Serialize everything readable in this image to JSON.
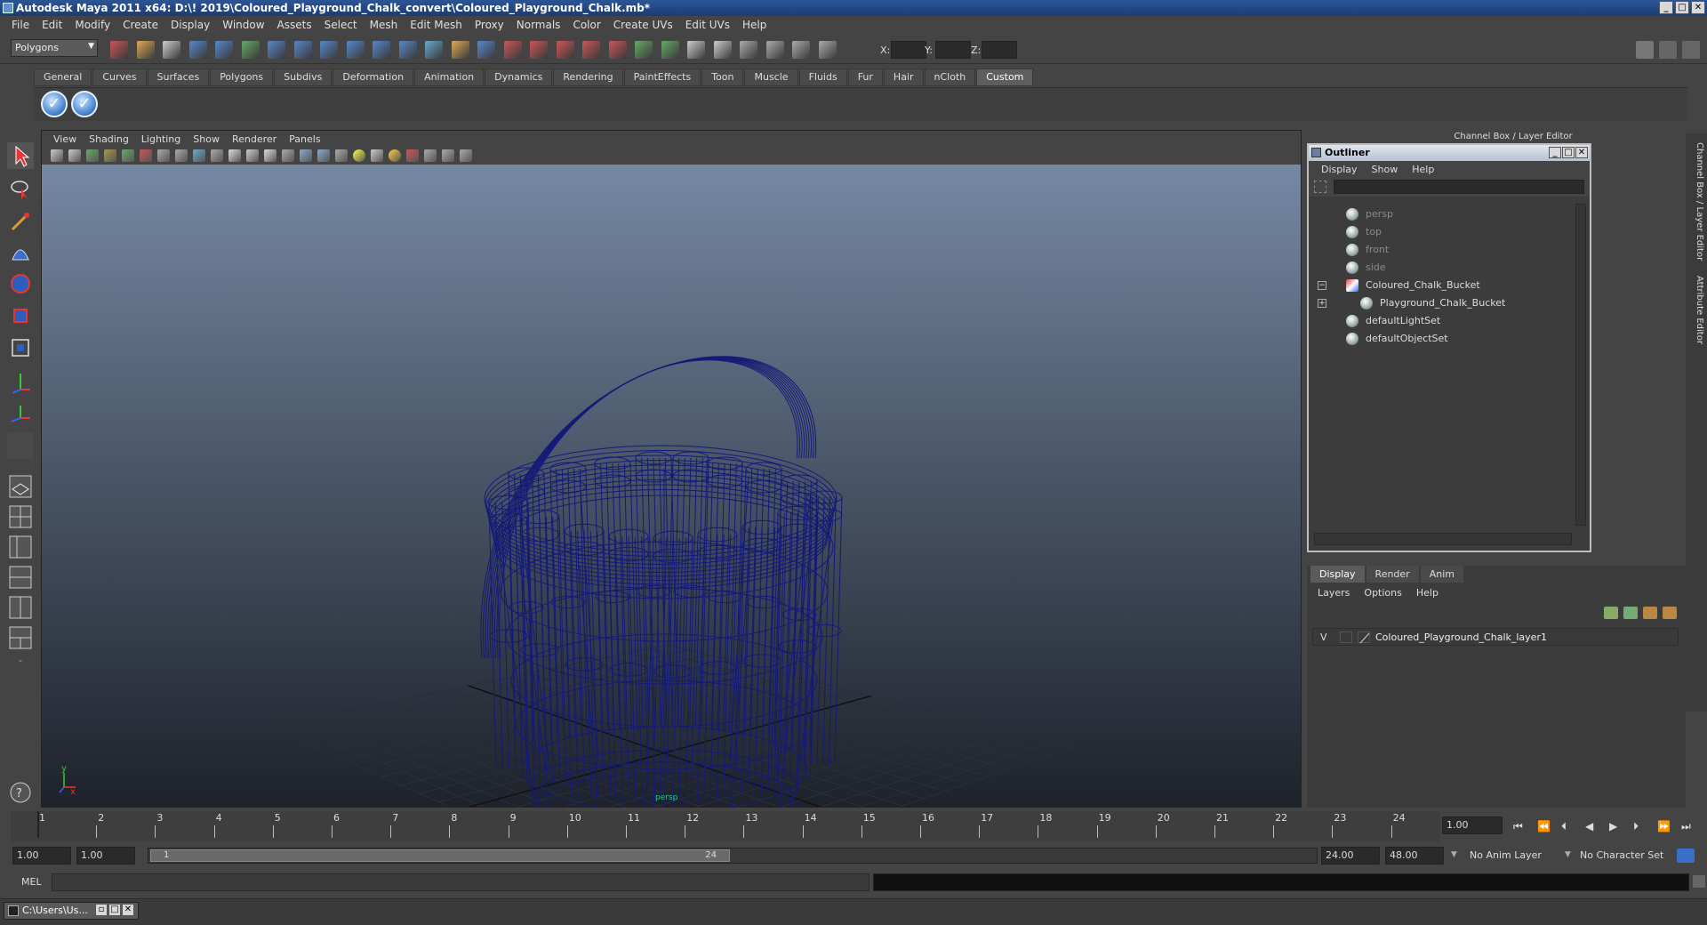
{
  "window": {
    "title": "Autodesk Maya 2011 x64: D:\\! 2019\\Coloured_Playground_Chalk_convert\\Coloured_Playground_Chalk.mb*"
  },
  "menubar": [
    "File",
    "Edit",
    "Modify",
    "Create",
    "Display",
    "Window",
    "Assets",
    "Select",
    "Mesh",
    "Edit Mesh",
    "Proxy",
    "Normals",
    "Color",
    "Create UVs",
    "Edit UVs",
    "Help"
  ],
  "statusline": {
    "mode": "Polygons",
    "x_label": "X:",
    "y_label": "Y:",
    "z_label": "Z:"
  },
  "shelf": {
    "tabs": [
      "General",
      "Curves",
      "Surfaces",
      "Polygons",
      "Subdivs",
      "Deformation",
      "Animation",
      "Dynamics",
      "Rendering",
      "PaintEffects",
      "Toon",
      "Muscle",
      "Fluids",
      "Fur",
      "Hair",
      "nCloth",
      "Custom"
    ],
    "active": "Custom",
    "buttons": [
      "check-icon",
      "check-icon"
    ]
  },
  "viewport": {
    "menus": [
      "View",
      "Shading",
      "Lighting",
      "Show",
      "Renderer",
      "Panels"
    ],
    "camera": "persp",
    "axis_y": "y",
    "axis_x": "x",
    "wire_color": "#141a78"
  },
  "channel_box_title": "Channel Box / Layer Editor",
  "side_tabs": [
    "Channel Box / Layer Editor",
    "Attribute Editor"
  ],
  "outliner": {
    "title": "Outliner",
    "menus": [
      "Display",
      "Show",
      "Help"
    ],
    "items": [
      {
        "label": "persp",
        "dim": true
      },
      {
        "label": "top",
        "dim": true
      },
      {
        "label": "front",
        "dim": true
      },
      {
        "label": "side",
        "dim": true
      },
      {
        "label": "Coloured_Chalk_Bucket",
        "dim": false
      },
      {
        "label": "Playground_Chalk_Bucket",
        "dim": false
      },
      {
        "label": "defaultLightSet",
        "dim": false
      },
      {
        "label": "defaultObjectSet",
        "dim": false
      }
    ]
  },
  "layer_editor": {
    "tabs": [
      "Display",
      "Render",
      "Anim"
    ],
    "menus": [
      "Layers",
      "Options",
      "Help"
    ],
    "layer": {
      "visible": "V",
      "name": "Coloured_Playground_Chalk_layer1"
    }
  },
  "timeline": {
    "ticks": [
      "1",
      "2",
      "3",
      "4",
      "5",
      "6",
      "7",
      "8",
      "9",
      "10",
      "11",
      "12",
      "13",
      "14",
      "15",
      "16",
      "17",
      "18",
      "19",
      "20",
      "21",
      "22",
      "23",
      "24"
    ],
    "current_frame": "1.00"
  },
  "range": {
    "start": "1.00",
    "playback_start": "1.00",
    "slider_start": "1",
    "slider_end": "24",
    "playback_end": "24.00",
    "end": "48.00",
    "anim_layer": "No Anim Layer",
    "char_set": "No Character Set"
  },
  "cmdline": {
    "label": "MEL"
  },
  "taskbar": {
    "item": "C:\\Users\\Us..."
  }
}
